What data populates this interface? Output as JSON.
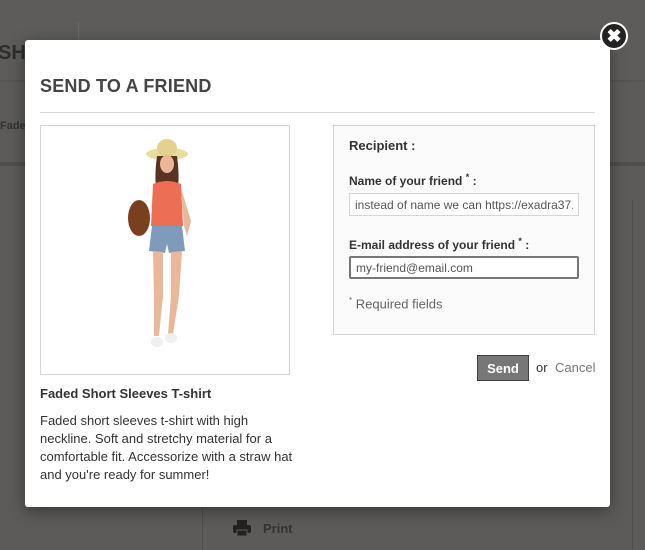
{
  "background": {
    "heading_fragment": "SHI",
    "breadcrumb_fragment": "Fade",
    "print_label": "Print"
  },
  "modal": {
    "title": "SEND TO A FRIEND",
    "close_icon": "close-icon",
    "product": {
      "name": "Faded Short Sleeves T-shirt",
      "description": "Faded short sleeves t-shirt with high neckline. Soft and stretchy material for a comfortable fit. Accessorize with a straw hat and you're ready for summer!"
    },
    "form": {
      "recipient_label": "Recipient :",
      "name_label": "Name of your friend",
      "name_value": "instead of name we can https://exadra37.",
      "email_label": "E-mail address of your friend",
      "email_value": "my-friend@email.com",
      "required_mark": "*",
      "colon": ":",
      "required_note": "Required fields"
    },
    "send_label": "Send",
    "or_label": "or",
    "cancel_label": "Cancel"
  }
}
